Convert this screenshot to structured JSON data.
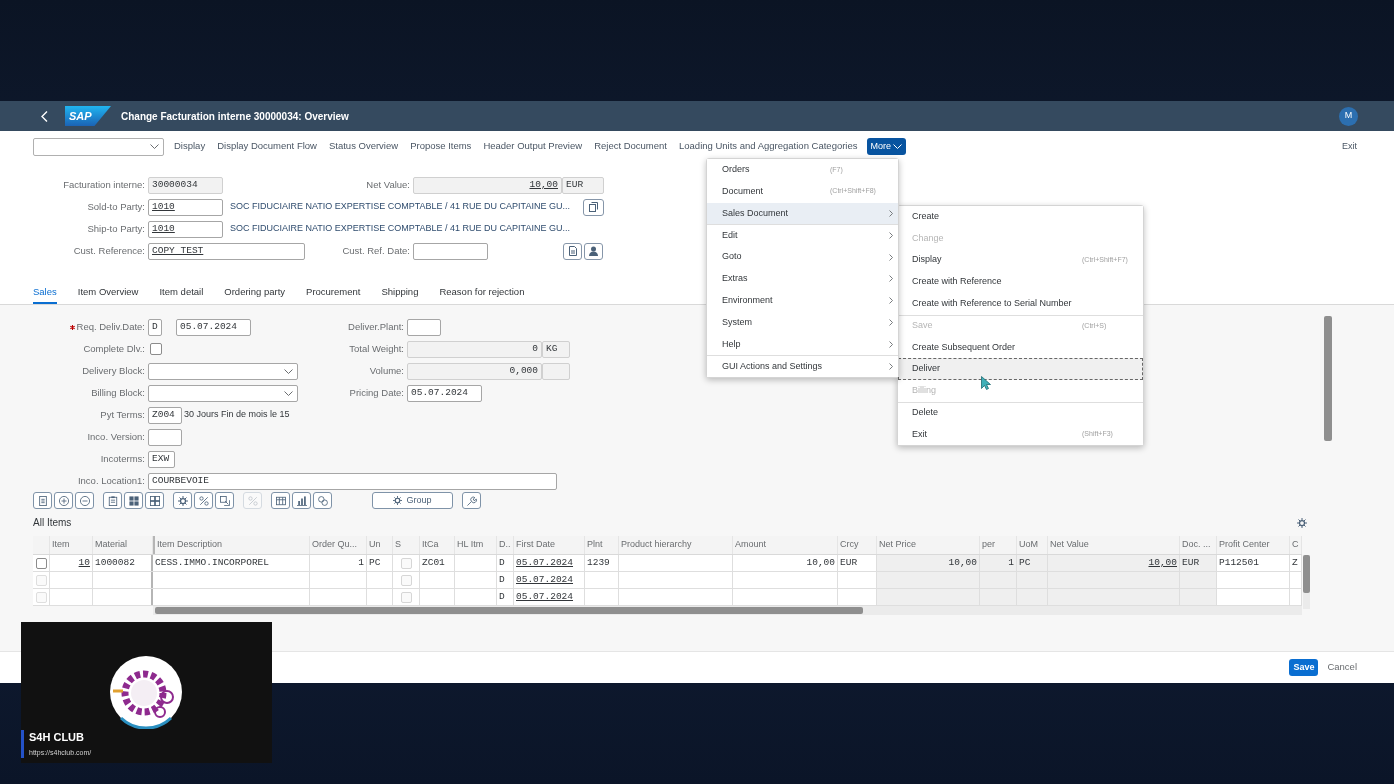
{
  "header": {
    "logo": "SAP",
    "title": "Change Facturation interne 30000034: Overview",
    "avatar": "M"
  },
  "toolbar": {
    "actions": [
      "Display",
      "Display Document Flow",
      "Status Overview",
      "Propose Items",
      "Header Output Preview",
      "Reject Document",
      "Loading Units and Aggregation Categories"
    ],
    "more": {
      "label": "More",
      "expanded": true
    },
    "exit": "Exit"
  },
  "document_header": {
    "document": {
      "label": "Facturation interne:",
      "value": "30000034"
    },
    "net_value": {
      "label": "Net Value:",
      "value": "10,00",
      "currency": "EUR"
    },
    "sold_to": {
      "label": "Sold-to Party:",
      "value": "1010",
      "description": "SOC FIDUCIAIRE NATIO EXPERTISE COMPTABLE / 41 RUE DU CAPITAINE GU..."
    },
    "ship_to": {
      "label": "Ship-to Party:",
      "value": "1010",
      "description": "SOC FIDUCIAIRE NATIO EXPERTISE COMPTABLE / 41 RUE DU CAPITAINE GU..."
    },
    "cust_reference": {
      "label": "Cust. Reference:",
      "value": "COPY TEST"
    },
    "cust_ref_date": {
      "label": "Cust. Ref. Date:"
    }
  },
  "tabs": [
    {
      "label": "Sales",
      "selected": true
    },
    {
      "label": "Item Overview",
      "selected": false
    },
    {
      "label": "Item detail",
      "selected": false
    },
    {
      "label": "Ordering party",
      "selected": false
    },
    {
      "label": "Procurement",
      "selected": false
    },
    {
      "label": "Shipping",
      "selected": false
    },
    {
      "label": "Reason for rejection",
      "selected": false
    }
  ],
  "sales": {
    "req_deliv_date": {
      "label": "Req. Deliv.Date:",
      "required": true,
      "period": "D",
      "value": "05.07.2024"
    },
    "complete_dlv": {
      "label": "Complete Dlv.:",
      "checked": false
    },
    "delivery_block": {
      "label": "Delivery Block:"
    },
    "billing_block": {
      "label": "Billing Block:"
    },
    "payment_terms": {
      "label": "Pyt Terms:",
      "value": "Z004",
      "description": "30 Jours Fin de mois le 15"
    },
    "inco_version": {
      "label": "Inco. Version:"
    },
    "incoterms": {
      "label": "Incoterms:",
      "value": "EXW"
    },
    "inco_location": {
      "label": "Inco. Location1:",
      "value": "COURBEVOIE"
    },
    "delivering_plant": {
      "label": "Deliver.Plant:"
    },
    "total_weight": {
      "label": "Total Weight:",
      "value": "0",
      "unit": "KG"
    },
    "volume": {
      "label": "Volume:",
      "value": "0,000"
    },
    "pricing_date": {
      "label": "Pricing Date:",
      "value": "05.07.2024"
    }
  },
  "table_toolbar": [
    {
      "kind": "icon",
      "disabled": false
    },
    {
      "kind": "icon",
      "disabled": false
    },
    {
      "kind": "icon",
      "disabled": false
    },
    {
      "kind": "icon",
      "disabled": false
    },
    {
      "kind": "icon",
      "disabled": false
    },
    {
      "kind": "icon",
      "disabled": false
    },
    {
      "kind": "icon",
      "disabled": false
    },
    {
      "kind": "icon",
      "disabled": false
    },
    {
      "kind": "icon",
      "disabled": false
    },
    {
      "kind": "icon",
      "disabled": true
    },
    {
      "kind": "icon",
      "disabled": false
    },
    {
      "kind": "icon",
      "disabled": false
    },
    {
      "kind": "icon",
      "disabled": false
    },
    {
      "kind": "text",
      "label": "Group",
      "disabled": false
    },
    {
      "kind": "icon",
      "disabled": false
    }
  ],
  "items_table": {
    "title": "All Items",
    "columns": [
      {
        "label": "Item",
        "kind": "link_number"
      },
      {
        "label": "Material",
        "kind": "text"
      },
      {
        "label": "Item Description",
        "kind": "text"
      },
      {
        "label": "Order Qu...",
        "kind": "number"
      },
      {
        "label": "Un",
        "kind": "text"
      },
      {
        "label": "S",
        "kind": "checkbox"
      },
      {
        "label": "ItCa",
        "kind": "text"
      },
      {
        "label": "HL Itm",
        "kind": "text"
      },
      {
        "label": "D..",
        "kind": "text"
      },
      {
        "label": "First Date",
        "kind": "link"
      },
      {
        "label": "Plnt",
        "kind": "text"
      },
      {
        "label": "Product hierarchy",
        "kind": "text"
      },
      {
        "label": "Amount",
        "kind": "number"
      },
      {
        "label": "Crcy",
        "kind": "text"
      },
      {
        "label": "Net Price",
        "kind": "readonly_number"
      },
      {
        "label": "per",
        "kind": "readonly_number"
      },
      {
        "label": "UoM",
        "kind": "readonly_text"
      },
      {
        "label": "Net Value",
        "kind": "readonly_link_number"
      },
      {
        "label": "Doc. ...",
        "kind": "readonly_text"
      },
      {
        "label": "Profit Center",
        "kind": "text"
      },
      {
        "label": "C",
        "kind": "text"
      }
    ],
    "rows": [
      {
        "checked": false,
        "disabled": false,
        "cells": [
          "10",
          "1000082",
          "CESS.IMMO.INCORPOREL",
          "1",
          "PC",
          false,
          "ZC01",
          null,
          "D",
          "05.07.2024",
          "1239",
          null,
          "10,00",
          "EUR",
          "10,00",
          "1",
          "PC",
          "10,00",
          "EUR",
          "P112501",
          "Z"
        ]
      },
      {
        "checked": false,
        "disabled": true,
        "cells": [
          null,
          null,
          null,
          null,
          null,
          false,
          null,
          null,
          "D",
          "05.07.2024",
          null,
          null,
          null,
          null,
          null,
          null,
          null,
          null,
          null,
          null,
          null
        ]
      },
      {
        "checked": false,
        "disabled": true,
        "cells": [
          null,
          null,
          null,
          null,
          null,
          false,
          null,
          null,
          "D",
          "05.07.2024",
          null,
          null,
          null,
          null,
          null,
          null,
          null,
          null,
          null,
          null,
          null
        ]
      }
    ]
  },
  "footer": {
    "buttons": [
      {
        "label": "Save",
        "kind": "emphasized"
      },
      {
        "label": "Cancel",
        "kind": "transparent"
      }
    ]
  },
  "more_menu": {
    "items": [
      {
        "label": "Orders",
        "shortcut": "(F7)",
        "submenu": false,
        "selected": false,
        "separator": false
      },
      {
        "label": "Document",
        "shortcut": "(Ctrl+Shift+F8)",
        "submenu": false,
        "selected": false,
        "separator": false
      },
      {
        "label": "Sales Document",
        "submenu": true,
        "selected": true,
        "separator": false,
        "children": [
          {
            "label": "Create",
            "disabled": false,
            "focused": false,
            "separator": false
          },
          {
            "label": "Change",
            "disabled": true,
            "focused": false,
            "separator": false
          },
          {
            "label": "Display",
            "shortcut": "(Ctrl+Shift+F7)",
            "disabled": false,
            "focused": false,
            "separator": false
          },
          {
            "label": "Create with Reference",
            "disabled": false,
            "focused": false,
            "separator": false
          },
          {
            "label": "Create with Reference to Serial Number",
            "disabled": false,
            "focused": false,
            "separator": false
          },
          {
            "label": "Save",
            "shortcut": "(Ctrl+S)",
            "disabled": true,
            "focused": false,
            "separator": true
          },
          {
            "label": "Create Subsequent Order",
            "disabled": false,
            "focused": false,
            "separator": false
          },
          {
            "label": "Deliver",
            "disabled": false,
            "focused": true,
            "separator": false
          },
          {
            "label": "Billing",
            "disabled": true,
            "focused": false,
            "separator": false
          },
          {
            "label": "Delete",
            "disabled": false,
            "focused": false,
            "separator": true
          },
          {
            "label": "Exit",
            "shortcut": "(Shift+F3)",
            "disabled": false,
            "focused": false,
            "separator": false
          }
        ]
      },
      {
        "label": "Edit",
        "submenu": true,
        "selected": false,
        "separator": true
      },
      {
        "label": "Goto",
        "submenu": true,
        "selected": false,
        "separator": false
      },
      {
        "label": "Extras",
        "submenu": true,
        "selected": false,
        "separator": false
      },
      {
        "label": "Environment",
        "submenu": true,
        "selected": false,
        "separator": false
      },
      {
        "label": "System",
        "submenu": true,
        "selected": false,
        "separator": false
      },
      {
        "label": "Help",
        "submenu": true,
        "selected": false,
        "separator": false
      },
      {
        "label": "GUI Actions and Settings",
        "submenu": true,
        "selected": false,
        "separator": true
      }
    ]
  },
  "presenter": {
    "name": "S4H CLUB",
    "url": "https://s4hclub.com/"
  }
}
